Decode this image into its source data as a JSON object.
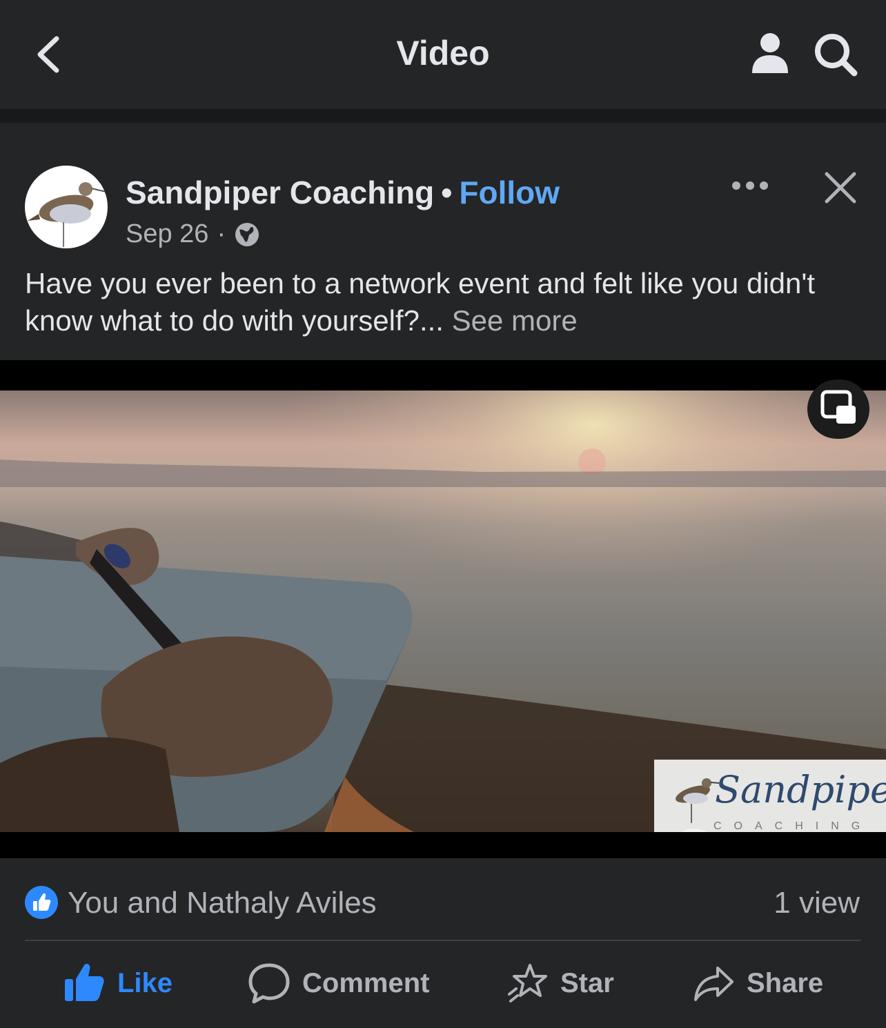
{
  "header": {
    "title": "Video"
  },
  "post": {
    "author": "Sandpiper Coaching",
    "separator": "•",
    "follow_label": "Follow",
    "date": "Sep 26",
    "date_sep": "·",
    "privacy_icon": "globe-icon",
    "text": "Have you ever been to a network event and felt like you didn't know what to do with yourself?...",
    "see_more": "See more"
  },
  "video": {
    "watermark_script": "Sandpiper",
    "watermark_sub": "COACHING"
  },
  "reactions": {
    "reactors": "You and Nathaly Aviles",
    "views": "1 view"
  },
  "actions": {
    "like": "Like",
    "comment": "Comment",
    "star": "Star",
    "share": "Share"
  },
  "colors": {
    "background": "#242526",
    "accent": "#2e89ff",
    "follow": "#5fa8f5",
    "secondary_text": "#b0b3b8"
  }
}
